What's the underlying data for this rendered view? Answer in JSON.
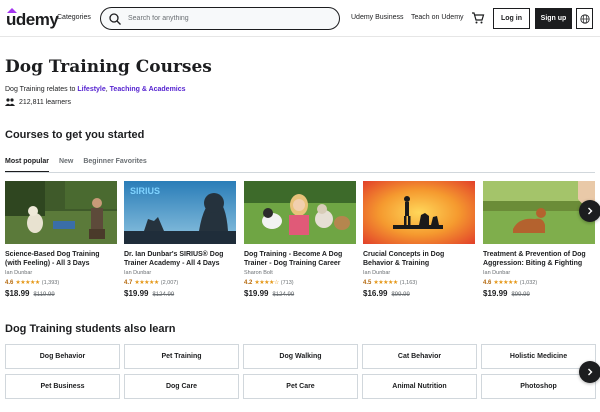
{
  "header": {
    "logo_text": "udemy",
    "categories_label": "Categories",
    "search_placeholder": "Search for anything",
    "business_label": "Udemy Business",
    "teach_label": "Teach on Udemy",
    "login_label": "Log in",
    "signup_label": "Sign up",
    "accent_color": "#a435f0"
  },
  "hero": {
    "title": "Dog Training Courses",
    "relates_prefix": "Dog Training relates to ",
    "relates_link1": "Lifestyle",
    "relates_sep": ", ",
    "relates_link2": "Teaching & Academics",
    "learners": "212,811 learners"
  },
  "courses_section": {
    "title": "Courses to get you started",
    "tabs": [
      {
        "label": "Most popular",
        "active": true
      },
      {
        "label": "New",
        "active": false
      },
      {
        "label": "Beginner Favorites",
        "active": false
      }
    ],
    "courses": [
      {
        "title": "Science-Based Dog Training (with Feeling) - All 3 Days",
        "author": "Ian Dunbar",
        "rating": "4.6",
        "stars": "★★★★★",
        "count": "(1,393)",
        "price": "$18.99",
        "old_price": "$119.99"
      },
      {
        "title": "Dr. Ian Dunbar's SIRIUS® Dog Trainer Academy - All 4 Days",
        "author": "Ian Dunbar",
        "rating": "4.7",
        "stars": "★★★★★",
        "count": "(2,007)",
        "price": "$19.99",
        "old_price": "$124.99"
      },
      {
        "title": "Dog Training - Become A Dog Trainer - Dog Training Career",
        "author": "Sharon Bolt",
        "rating": "4.2",
        "stars": "★★★★☆",
        "count": "(713)",
        "price": "$19.99",
        "old_price": "$124.99"
      },
      {
        "title": "Crucial Concepts in Dog Behavior & Training",
        "author": "Ian Dunbar",
        "rating": "4.5",
        "stars": "★★★★★",
        "count": "(1,163)",
        "price": "$16.99",
        "old_price": "$99.99"
      },
      {
        "title": "Treatment & Prevention of Dog Aggression: Biting & Fighting",
        "author": "Ian Dunbar",
        "rating": "4.6",
        "stars": "★★★★★",
        "count": "(1,032)",
        "price": "$19.99",
        "old_price": "$99.99"
      }
    ],
    "thumb_text_sirius": "SIRIUS"
  },
  "topics_section": {
    "title": "Dog Training students also learn",
    "topics": [
      "Dog Behavior",
      "Pet Training",
      "Dog Walking",
      "Cat Behavior",
      "Holistic Medicine",
      "Pet Business",
      "Dog Care",
      "Pet Care",
      "Animal Nutrition",
      "Photoshop"
    ]
  }
}
